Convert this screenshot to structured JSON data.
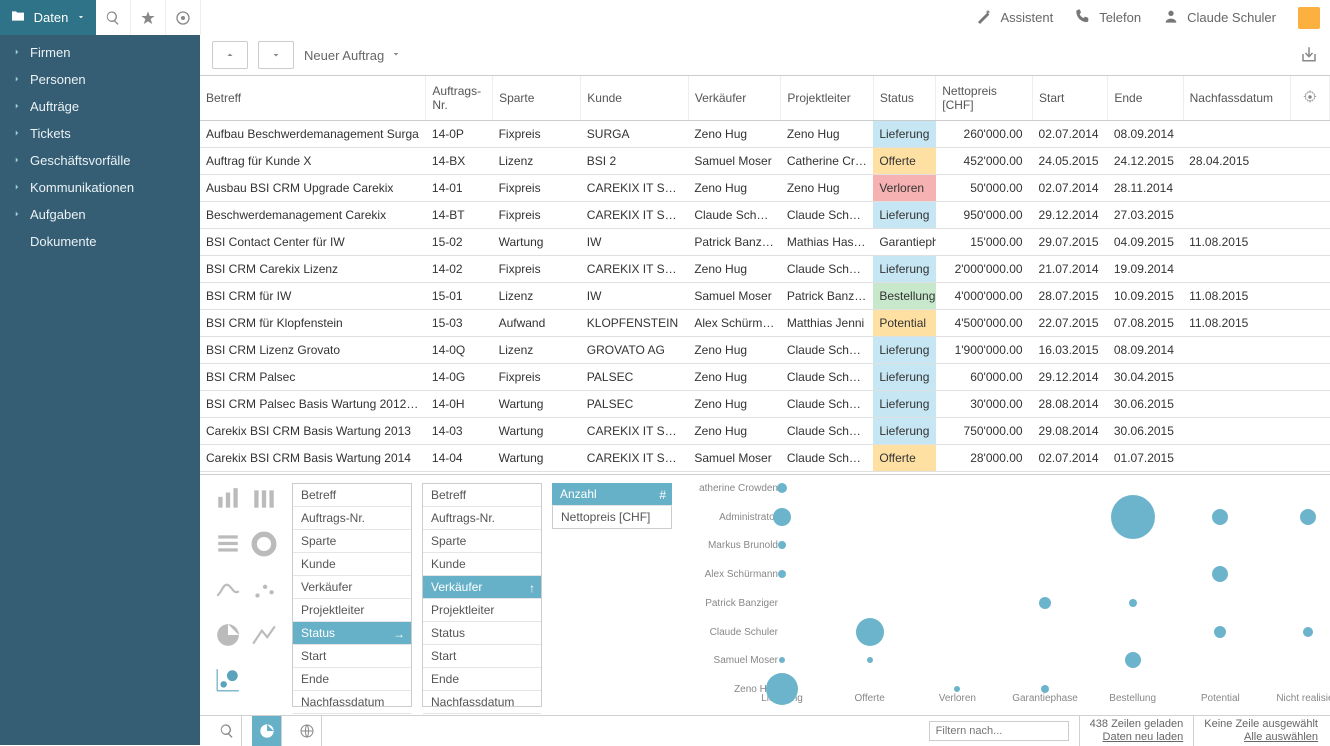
{
  "topbar": {
    "section": "Daten",
    "assistant": "Assistent",
    "telefon": "Telefon",
    "user": "Claude Schuler"
  },
  "sidebar": {
    "items": [
      "Firmen",
      "Personen",
      "Aufträge",
      "Tickets",
      "Geschäftsvorfälle",
      "Kommunikationen",
      "Aufgaben",
      "Dokumente"
    ]
  },
  "toolbar": {
    "new_label": "Neuer Auftrag"
  },
  "columns": {
    "betreff": "Betreff",
    "auftragsnr": "Auftrags-Nr.",
    "sparte": "Sparte",
    "kunde": "Kunde",
    "verkaeufer": "Verkäufer",
    "projektleiter": "Projektleiter",
    "status": "Status",
    "nettopreis": "Nettopreis [CHF]",
    "start": "Start",
    "ende": "Ende",
    "nachfass": "Nachfassdatum"
  },
  "rows": [
    {
      "betreff": "Aufbau Beschwerdemanagement Surga",
      "nr": "14-0P",
      "sparte": "Fixpreis",
      "kunde": "SURGA",
      "verk": "Zeno Hug",
      "pl": "Zeno Hug",
      "status": "Lieferung",
      "preis": "260'000.00",
      "start": "02.07.2014",
      "ende": "08.09.2014",
      "nf": ""
    },
    {
      "betreff": "Auftrag für Kunde X",
      "nr": "14-BX",
      "sparte": "Lizenz",
      "kunde": "BSI 2",
      "verk": "Samuel Moser",
      "pl": "Catherine Crow...",
      "status": "Offerte",
      "preis": "452'000.00",
      "start": "24.05.2015",
      "ende": "24.12.2015",
      "nf": "28.04.2015"
    },
    {
      "betreff": "Ausbau BSI CRM Upgrade Carekix",
      "nr": "14-01",
      "sparte": "Fixpreis",
      "kunde": "CAREKIX IT SERVI...",
      "verk": "Zeno Hug",
      "pl": "Zeno Hug",
      "status": "Verloren",
      "preis": "50'000.00",
      "start": "02.07.2014",
      "ende": "28.11.2014",
      "nf": ""
    },
    {
      "betreff": "Beschwerdemanagement Carekix",
      "nr": "14-BT",
      "sparte": "Fixpreis",
      "kunde": "CAREKIX IT SERVI...",
      "verk": "Claude Schuler",
      "pl": "Claude Schuler",
      "status": "Lieferung",
      "preis": "950'000.00",
      "start": "29.12.2014",
      "ende": "27.03.2015",
      "nf": ""
    },
    {
      "betreff": "BSI Contact Center für IW",
      "nr": "15-02",
      "sparte": "Wartung",
      "kunde": "IW",
      "verk": "Patrick Banziger",
      "pl": "Mathias Hassler",
      "status": "Garantieph...",
      "preis": "15'000.00",
      "start": "29.07.2015",
      "ende": "04.09.2015",
      "nf": "11.08.2015"
    },
    {
      "betreff": "BSI CRM Carekix Lizenz",
      "nr": "14-02",
      "sparte": "Fixpreis",
      "kunde": "CAREKIX IT SERVI...",
      "verk": "Zeno Hug",
      "pl": "Claude Schuler",
      "status": "Lieferung",
      "preis": "2'000'000.00",
      "start": "21.07.2014",
      "ende": "19.09.2014",
      "nf": ""
    },
    {
      "betreff": "BSI CRM für IW",
      "nr": "15-01",
      "sparte": "Lizenz",
      "kunde": "IW",
      "verk": "Samuel Moser",
      "pl": "Patrick Banziger",
      "status": "Bestellung",
      "preis": "4'000'000.00",
      "start": "28.07.2015",
      "ende": "10.09.2015",
      "nf": "11.08.2015"
    },
    {
      "betreff": "BSI CRM für Klopfenstein",
      "nr": "15-03",
      "sparte": "Aufwand",
      "kunde": "KLOPFENSTEIN",
      "verk": "Alex Schürmann",
      "pl": "Matthias Jenni",
      "status": "Potential",
      "preis": "4'500'000.00",
      "start": "22.07.2015",
      "ende": "07.08.2015",
      "nf": "11.08.2015"
    },
    {
      "betreff": "BSI CRM Lizenz Grovato",
      "nr": "14-0Q",
      "sparte": "Lizenz",
      "kunde": "GROVATO AG",
      "verk": "Zeno Hug",
      "pl": "Claude Schuler",
      "status": "Lieferung",
      "preis": "1'900'000.00",
      "start": "16.03.2015",
      "ende": "08.09.2014",
      "nf": ""
    },
    {
      "betreff": "BSI CRM Palsec",
      "nr": "14-0G",
      "sparte": "Fixpreis",
      "kunde": "PALSEC",
      "verk": "Zeno Hug",
      "pl": "Claude Schuler",
      "status": "Lieferung",
      "preis": "60'000.00",
      "start": "29.12.2014",
      "ende": "30.04.2015",
      "nf": ""
    },
    {
      "betreff": "BSI CRM Palsec Basis Wartung 2012/2013",
      "nr": "14-0H",
      "sparte": "Wartung",
      "kunde": "PALSEC",
      "verk": "Zeno Hug",
      "pl": "Claude Schuler",
      "status": "Lieferung",
      "preis": "30'000.00",
      "start": "28.08.2014",
      "ende": "30.06.2015",
      "nf": ""
    },
    {
      "betreff": "Carekix BSI CRM Basis Wartung 2013",
      "nr": "14-03",
      "sparte": "Wartung",
      "kunde": "CAREKIX IT SERVI...",
      "verk": "Zeno Hug",
      "pl": "Claude Schuler",
      "status": "Lieferung",
      "preis": "750'000.00",
      "start": "29.08.2014",
      "ende": "30.06.2015",
      "nf": ""
    },
    {
      "betreff": "Carekix BSI CRM Basis Wartung 2014",
      "nr": "14-04",
      "sparte": "Wartung",
      "kunde": "CAREKIX IT SERVI...",
      "verk": "Samuel Moser",
      "pl": "Claude Schuler",
      "status": "Offerte",
      "preis": "28'000.00",
      "start": "02.07.2014",
      "ende": "01.07.2015",
      "nf": ""
    }
  ],
  "dims1": [
    "Betreff",
    "Auftrags-Nr.",
    "Sparte",
    "Kunde",
    "Verkäufer",
    "Projektleiter",
    "Status",
    "Start",
    "Ende",
    "Nachfassdatum"
  ],
  "dims1_sel": "Status",
  "dims2": [
    "Betreff",
    "Auftrags-Nr.",
    "Sparte",
    "Kunde",
    "Verkäufer",
    "Projektleiter",
    "Status",
    "Start",
    "Ende",
    "Nachfassdatum"
  ],
  "dims2_sel": "Verkäufer",
  "dims3": {
    "anzahl": "Anzahl",
    "netto": "Nettopreis [CHF]"
  },
  "chart_data": {
    "type": "scatter",
    "y_categories": [
      "atherine Crowden",
      "Administrator",
      "Markus Brunold",
      "Alex Schürmann",
      "Patrick Banziger",
      "Claude Schuler",
      "Samuel Moser",
      "Zeno Hug"
    ],
    "x_categories": [
      "Lieferung",
      "Offerte",
      "Verloren",
      "Garantiephase",
      "Bestellung",
      "Potential",
      "Nicht realisiert"
    ],
    "points": [
      {
        "x": 0,
        "y": 0,
        "r": 5
      },
      {
        "x": 0,
        "y": 1,
        "r": 9
      },
      {
        "x": 0,
        "y": 2,
        "r": 4
      },
      {
        "x": 0,
        "y": 3,
        "r": 4
      },
      {
        "x": 0,
        "y": 6,
        "r": 3
      },
      {
        "x": 0,
        "y": 7,
        "r": 16
      },
      {
        "x": 1,
        "y": 5,
        "r": 14
      },
      {
        "x": 1,
        "y": 6,
        "r": 3
      },
      {
        "x": 2,
        "y": 7,
        "r": 3
      },
      {
        "x": 3,
        "y": 4,
        "r": 6
      },
      {
        "x": 3,
        "y": 7,
        "r": 4
      },
      {
        "x": 4,
        "y": 1,
        "r": 22
      },
      {
        "x": 4,
        "y": 4,
        "r": 4
      },
      {
        "x": 4,
        "y": 6,
        "r": 8
      },
      {
        "x": 5,
        "y": 1,
        "r": 8
      },
      {
        "x": 5,
        "y": 3,
        "r": 8
      },
      {
        "x": 5,
        "y": 5,
        "r": 6
      },
      {
        "x": 6,
        "y": 1,
        "r": 8
      },
      {
        "x": 6,
        "y": 5,
        "r": 5
      }
    ]
  },
  "statusbar": {
    "filter_placeholder": "Filtern nach...",
    "loaded": "438 Zeilen geladen",
    "reload": "Daten neu laden",
    "selection": "Keine Zeile ausgewählt",
    "selectall": "Alle auswählen"
  }
}
